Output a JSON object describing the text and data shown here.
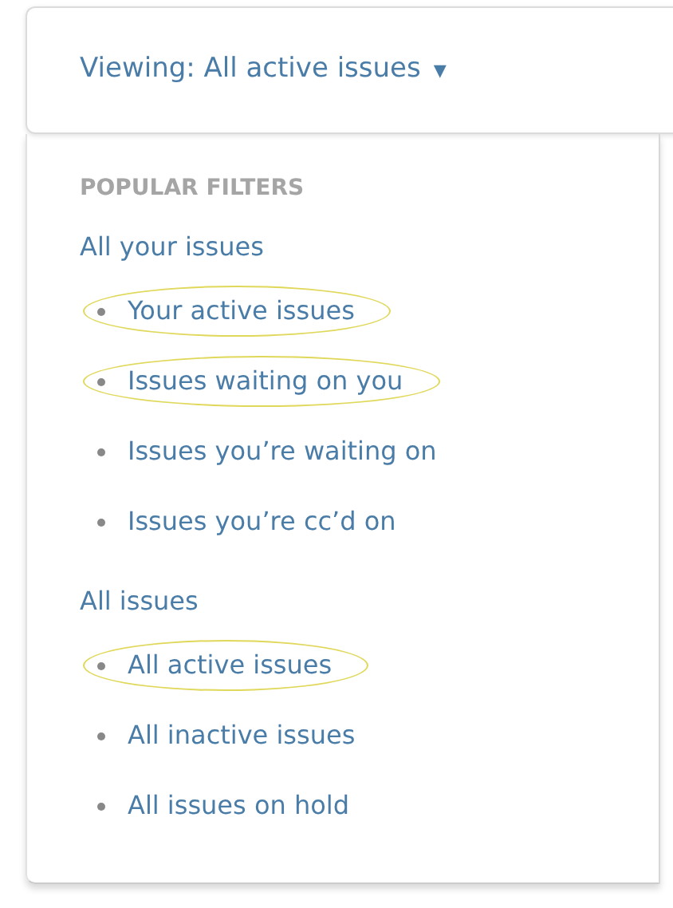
{
  "header": {
    "label": "Viewing: All active issues",
    "caret": "▾"
  },
  "section_title": "POPULAR FILTERS",
  "groups": [
    {
      "label": "All your issues",
      "items": [
        {
          "label": "Your active issues",
          "highlighted": true
        },
        {
          "label": "Issues waiting on you",
          "highlighted": true
        },
        {
          "label": "Issues you’re waiting on",
          "highlighted": false
        },
        {
          "label": "Issues you’re cc’d on",
          "highlighted": false
        }
      ]
    },
    {
      "label": "All issues",
      "items": [
        {
          "label": "All active issues",
          "highlighted": true
        },
        {
          "label": "All inactive issues",
          "highlighted": false
        },
        {
          "label": "All issues on hold",
          "highlighted": false
        }
      ]
    }
  ]
}
